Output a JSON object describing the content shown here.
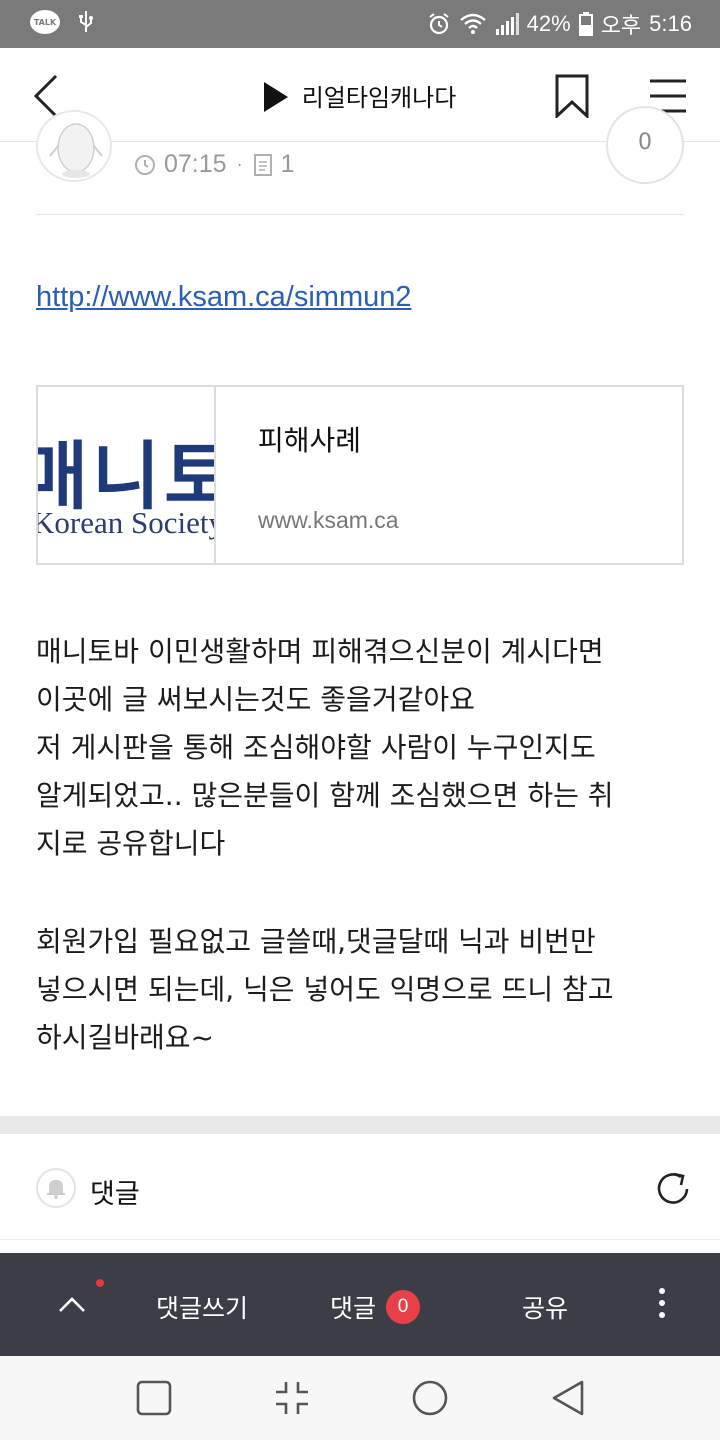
{
  "status_bar": {
    "talk_icon_label": "TALK",
    "battery": "42%",
    "ampm": "오후",
    "time": "5:16",
    "icons": [
      "kakaotalk-icon",
      "usb-icon",
      "alarm-icon",
      "wifi-icon",
      "signal-icon",
      "battery-icon"
    ]
  },
  "header": {
    "title": "리얼타임캐나다",
    "icons": [
      "back-icon",
      "play-icon",
      "bookmark-icon",
      "menu-icon"
    ]
  },
  "post_meta": {
    "time": "07:15",
    "comment_count": "1",
    "like_count": "0"
  },
  "post": {
    "link_text": "http://www.ksam.ca/simmun2",
    "preview": {
      "thumb_text_big": "매니토바",
      "thumb_text_small": "Korean Society",
      "title": "피해사례",
      "domain": "www.ksam.ca"
    },
    "body_lines": [
      "매니토바 이민생활하며 피해겪으신분이 계시다면",
      "이곳에 글 써보시는것도 좋을거같아요",
      "저 게시판을 통해 조심해야할 사람이 누구인지도",
      "알게되었고.. 많은분들이 함께 조심했으면 하는 취",
      "지로 공유합니다",
      "회원가입 필요없고 글쓸때,댓글달때 닉과 비번만",
      "넣으시면 되는데, 닉은 넣어도 익명으로 뜨니 참고",
      "하시길바래요~"
    ]
  },
  "comments": {
    "label": "댓글"
  },
  "action_bar": {
    "write_comment": "댓글쓰기",
    "comment": "댓글",
    "comment_badge": "0",
    "share": "공유"
  },
  "colors": {
    "link": "#2a5fb4",
    "action_bar_bg": "#3b3e47",
    "badge_red": "#e84048",
    "status_bar_bg": "#7a7a7a"
  }
}
